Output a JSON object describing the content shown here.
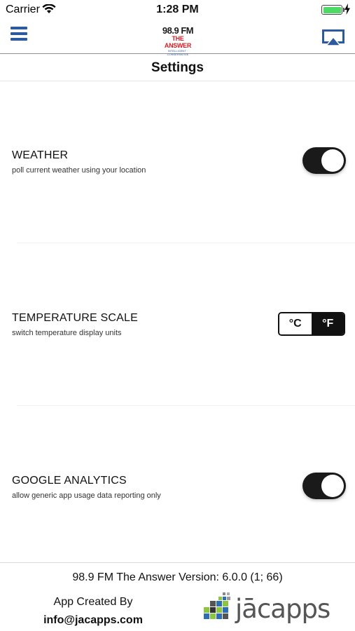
{
  "status_bar": {
    "carrier": "Carrier",
    "time": "1:28 PM",
    "battery_level": 1.0
  },
  "nav": {
    "logo_line1": "98.9 FM",
    "logo_line2": "THE ANSWER",
    "logo_line3": "INTELLIGENT · CONSERVATIVE",
    "accent_color": "#2c5a9e"
  },
  "page": {
    "title": "Settings"
  },
  "settings": [
    {
      "title": "WEATHER",
      "subtitle": "poll current weather using your location",
      "control": "toggle",
      "value": "on"
    },
    {
      "title": "TEMPERATURE SCALE",
      "subtitle": "switch temperature display units",
      "control": "segmented",
      "options": [
        "°C",
        "°F"
      ],
      "selected": "°F"
    },
    {
      "title": "GOOGLE ANALYTICS",
      "subtitle": "allow generic app usage data reporting only",
      "control": "toggle",
      "value": "on"
    }
  ],
  "footer": {
    "version": "98.9 FM The Answer Version: 6.0.0 (1; 66)",
    "created_by": "App Created By",
    "email": "info@jacapps.com",
    "brand": "jācapps"
  }
}
